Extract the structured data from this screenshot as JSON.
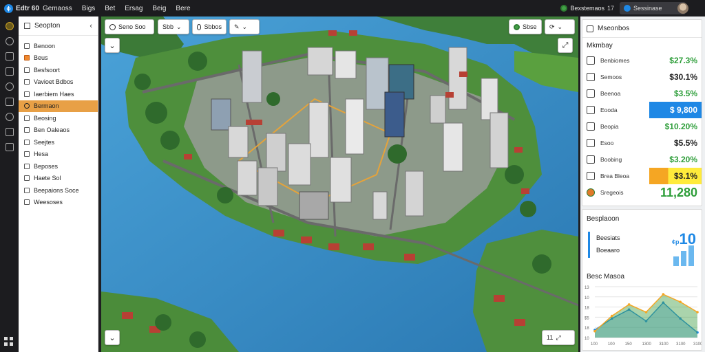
{
  "topbar": {
    "app_name": "Edtr 60",
    "menu": [
      "Gemaoss",
      "Bigs",
      "Bet",
      "Ersag",
      "Beig",
      "Bere"
    ],
    "status_label": "Bexstemaos",
    "status_count": "17",
    "search_text": "Sessinase"
  },
  "sidebar": {
    "title": "Seopton",
    "items": [
      {
        "label": "Benoon",
        "highlight": false
      },
      {
        "label": "Beus",
        "highlight": false,
        "orange": true
      },
      {
        "label": "Besfsoort",
        "highlight": false
      },
      {
        "label": "Vavioet Bdbos",
        "highlight": false
      },
      {
        "label": "Iaerbiem Haes",
        "highlight": false
      },
      {
        "label": "Bermaon",
        "highlight": true
      },
      {
        "label": "Beosing",
        "highlight": false
      },
      {
        "label": "Ben Oaleaos",
        "highlight": false
      },
      {
        "label": "Seejtes",
        "highlight": false
      },
      {
        "label": "Hesa",
        "highlight": false
      },
      {
        "label": "Beposes",
        "highlight": false
      },
      {
        "label": "Haete Sol",
        "highlight": false
      },
      {
        "label": "Beepaions Soce",
        "highlight": false
      },
      {
        "label": "Weesoses",
        "highlight": false
      }
    ]
  },
  "map": {
    "search_label": "Seno Soo",
    "filter_label": "Sbb",
    "layer_label": "Sbbos",
    "tool_label": "",
    "scene_label": "Sbse",
    "zoom_label": "11"
  },
  "resources": {
    "title": "Mseonbos",
    "subtitle": "Mkmbay",
    "rows": [
      {
        "label": "Benbiomes",
        "value": "$27.3%",
        "style": "green"
      },
      {
        "label": "Semoos",
        "value": "$30.1%",
        "style": "dark"
      },
      {
        "label": "Beenoa",
        "value": "$3.5%",
        "style": "green"
      },
      {
        "label": "Eooda",
        "value": "$ 9,800",
        "style": "blue"
      },
      {
        "label": "Beopia",
        "value": "$10.20%",
        "style": "green"
      },
      {
        "label": "Esoo",
        "value": "$5.5%",
        "style": "dark"
      },
      {
        "label": "Boobing",
        "value": "$3.20%",
        "style": "green"
      },
      {
        "label": "Brea Bleoa",
        "value": "$3.1%",
        "style": "orange"
      },
      {
        "label": "Sregeois",
        "value": "11,280",
        "style": "big"
      }
    ]
  },
  "stats": {
    "title": "Besplaoon",
    "label": "Beesiats",
    "label2": "Boeaaro",
    "value": "10",
    "value_prefix": "¢p"
  },
  "chart": {
    "title": "Besc Masoa",
    "y_ticks": [
      "13",
      "10",
      "18",
      "$5",
      "18",
      "10"
    ],
    "x_ticks": [
      "100",
      "100",
      "150",
      "1300",
      "3100",
      "3100",
      "3100"
    ]
  },
  "chart_data": {
    "type": "area",
    "categories": [
      "100",
      "100",
      "150",
      "1300",
      "3100",
      "3100",
      "3100"
    ],
    "series": [
      {
        "values": [
          12,
          30,
          44,
          26,
          55,
          30,
          8
        ]
      },
      {
        "values": [
          10,
          34,
          52,
          40,
          68,
          56,
          40
        ]
      }
    ],
    "ylim": [
      0,
      80
    ]
  },
  "colors": {
    "accent_orange": "#e8a046",
    "accent_blue": "#1e88e5",
    "value_green": "#2e9e3a",
    "water": "#3a8fc7"
  }
}
